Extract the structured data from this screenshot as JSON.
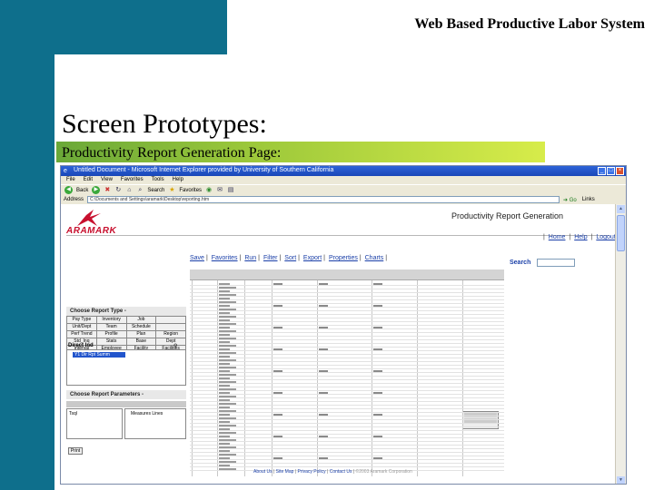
{
  "slide": {
    "header": "Web Based Productive Labor System",
    "title": "Screen Prototypes:",
    "subtitle": "Productivity Report Generation Page:"
  },
  "browser": {
    "title": "Untitled Document - Microsoft Internet Explorer provided by University of Southern California",
    "menu": [
      "File",
      "Edit",
      "View",
      "Favorites",
      "Tools",
      "Help"
    ],
    "toolbar": {
      "back": "Back",
      "search": "Search",
      "favorites": "Favorites"
    },
    "address_label": "Address",
    "address_value": "C:\\Documents and Settings\\aramark\\Desktop\\reporting.htm",
    "go_label": "Go",
    "links_label": "Links"
  },
  "page": {
    "brand": "ARAMARK",
    "title": "Productivity Report Generation",
    "nav": [
      "Home",
      "Help",
      "Logout"
    ],
    "actions": [
      "Save",
      "Favorites",
      "Run",
      "Filter",
      "Sort",
      "Export",
      "Properties",
      "Charts"
    ],
    "search_label": "Search",
    "left_panel": {
      "report_type_heading": "Choose Report Type -",
      "report_types": [
        "Pay Type",
        "Inventory",
        "Job",
        "",
        "Unit/Dept",
        "Team",
        "Schedule",
        "",
        "Perf Trend",
        "Profile",
        "Plan",
        "Region",
        "Std_Inq",
        "Stats",
        "Base",
        "Dept",
        "Interval",
        "Employee",
        "Facility",
        "Facilities"
      ],
      "direct_label": "Direct  Ind",
      "selected_item": "Y1 Dir Rpt Summ",
      "params_heading": "Choose Report Parameters -",
      "param_left": "Tsql",
      "param_right": "Measures Lines",
      "print_label": "Print"
    },
    "footer": {
      "links": [
        "About Us",
        "Site Map",
        "Privacy Policy",
        "Contact Us"
      ],
      "muted": "©2003 Aramark Corporation"
    }
  },
  "icons": {
    "browser": "ie-icon",
    "back": "back-arrow-icon",
    "forward": "forward-arrow-icon",
    "stop": "stop-icon",
    "refresh": "refresh-icon",
    "home": "home-icon",
    "search": "search-icon",
    "favorites": "star-icon",
    "media": "media-icon",
    "mail": "mail-icon",
    "print": "print-icon"
  },
  "colors": {
    "teal": "#0e6f8c",
    "green_bar": "#9cc83a",
    "link": "#1a3fa8",
    "brand_red": "#c8102e"
  }
}
